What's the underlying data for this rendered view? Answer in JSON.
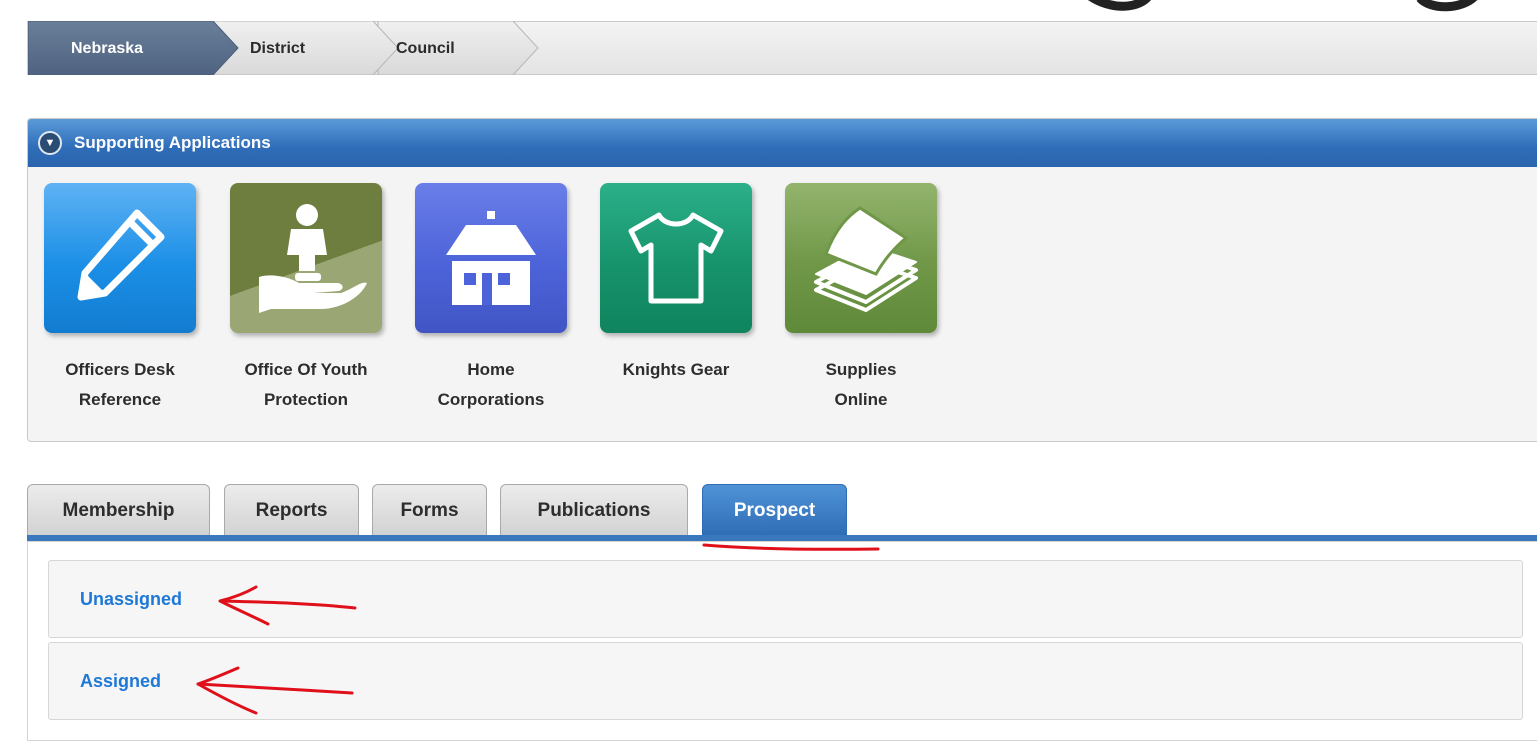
{
  "breadcrumb": {
    "items": [
      {
        "label": "Nebraska",
        "active": true
      },
      {
        "label": "District",
        "active": false
      },
      {
        "label": "Council",
        "active": false
      }
    ]
  },
  "supporting_apps": {
    "title": "Supporting Applications",
    "toggle_icon": "chevron-down-circle-icon",
    "apps": [
      {
        "label_line1": "Officers Desk",
        "label_line2": "Reference",
        "icon": "pencil-icon",
        "color": "#1b8fe6"
      },
      {
        "label_line1": "Office Of Youth",
        "label_line2": "Protection",
        "icon": "child-hand-icon",
        "color": "#6b7b3c"
      },
      {
        "label_line1": "Home",
        "label_line2": "Corporations",
        "icon": "house-icon",
        "color": "#4c63d9"
      },
      {
        "label_line1": "Knights Gear",
        "label_line2": "",
        "icon": "tshirt-icon",
        "color": "#17936b"
      },
      {
        "label_line1": "Supplies",
        "label_line2": "Online",
        "icon": "paper-stack-icon",
        "color": "#6f9747"
      }
    ]
  },
  "tabs": [
    {
      "label": "Membership",
      "active": false
    },
    {
      "label": "Reports",
      "active": false
    },
    {
      "label": "Forms",
      "active": false
    },
    {
      "label": "Publications",
      "active": false
    },
    {
      "label": "Prospect",
      "active": true
    }
  ],
  "prospect": {
    "links": [
      {
        "label": "Unassigned"
      },
      {
        "label": "Assigned"
      }
    ]
  },
  "colors": {
    "accent_blue": "#2f6cb5",
    "link_blue": "#1e78d6",
    "annotation_red": "#e0101a"
  }
}
